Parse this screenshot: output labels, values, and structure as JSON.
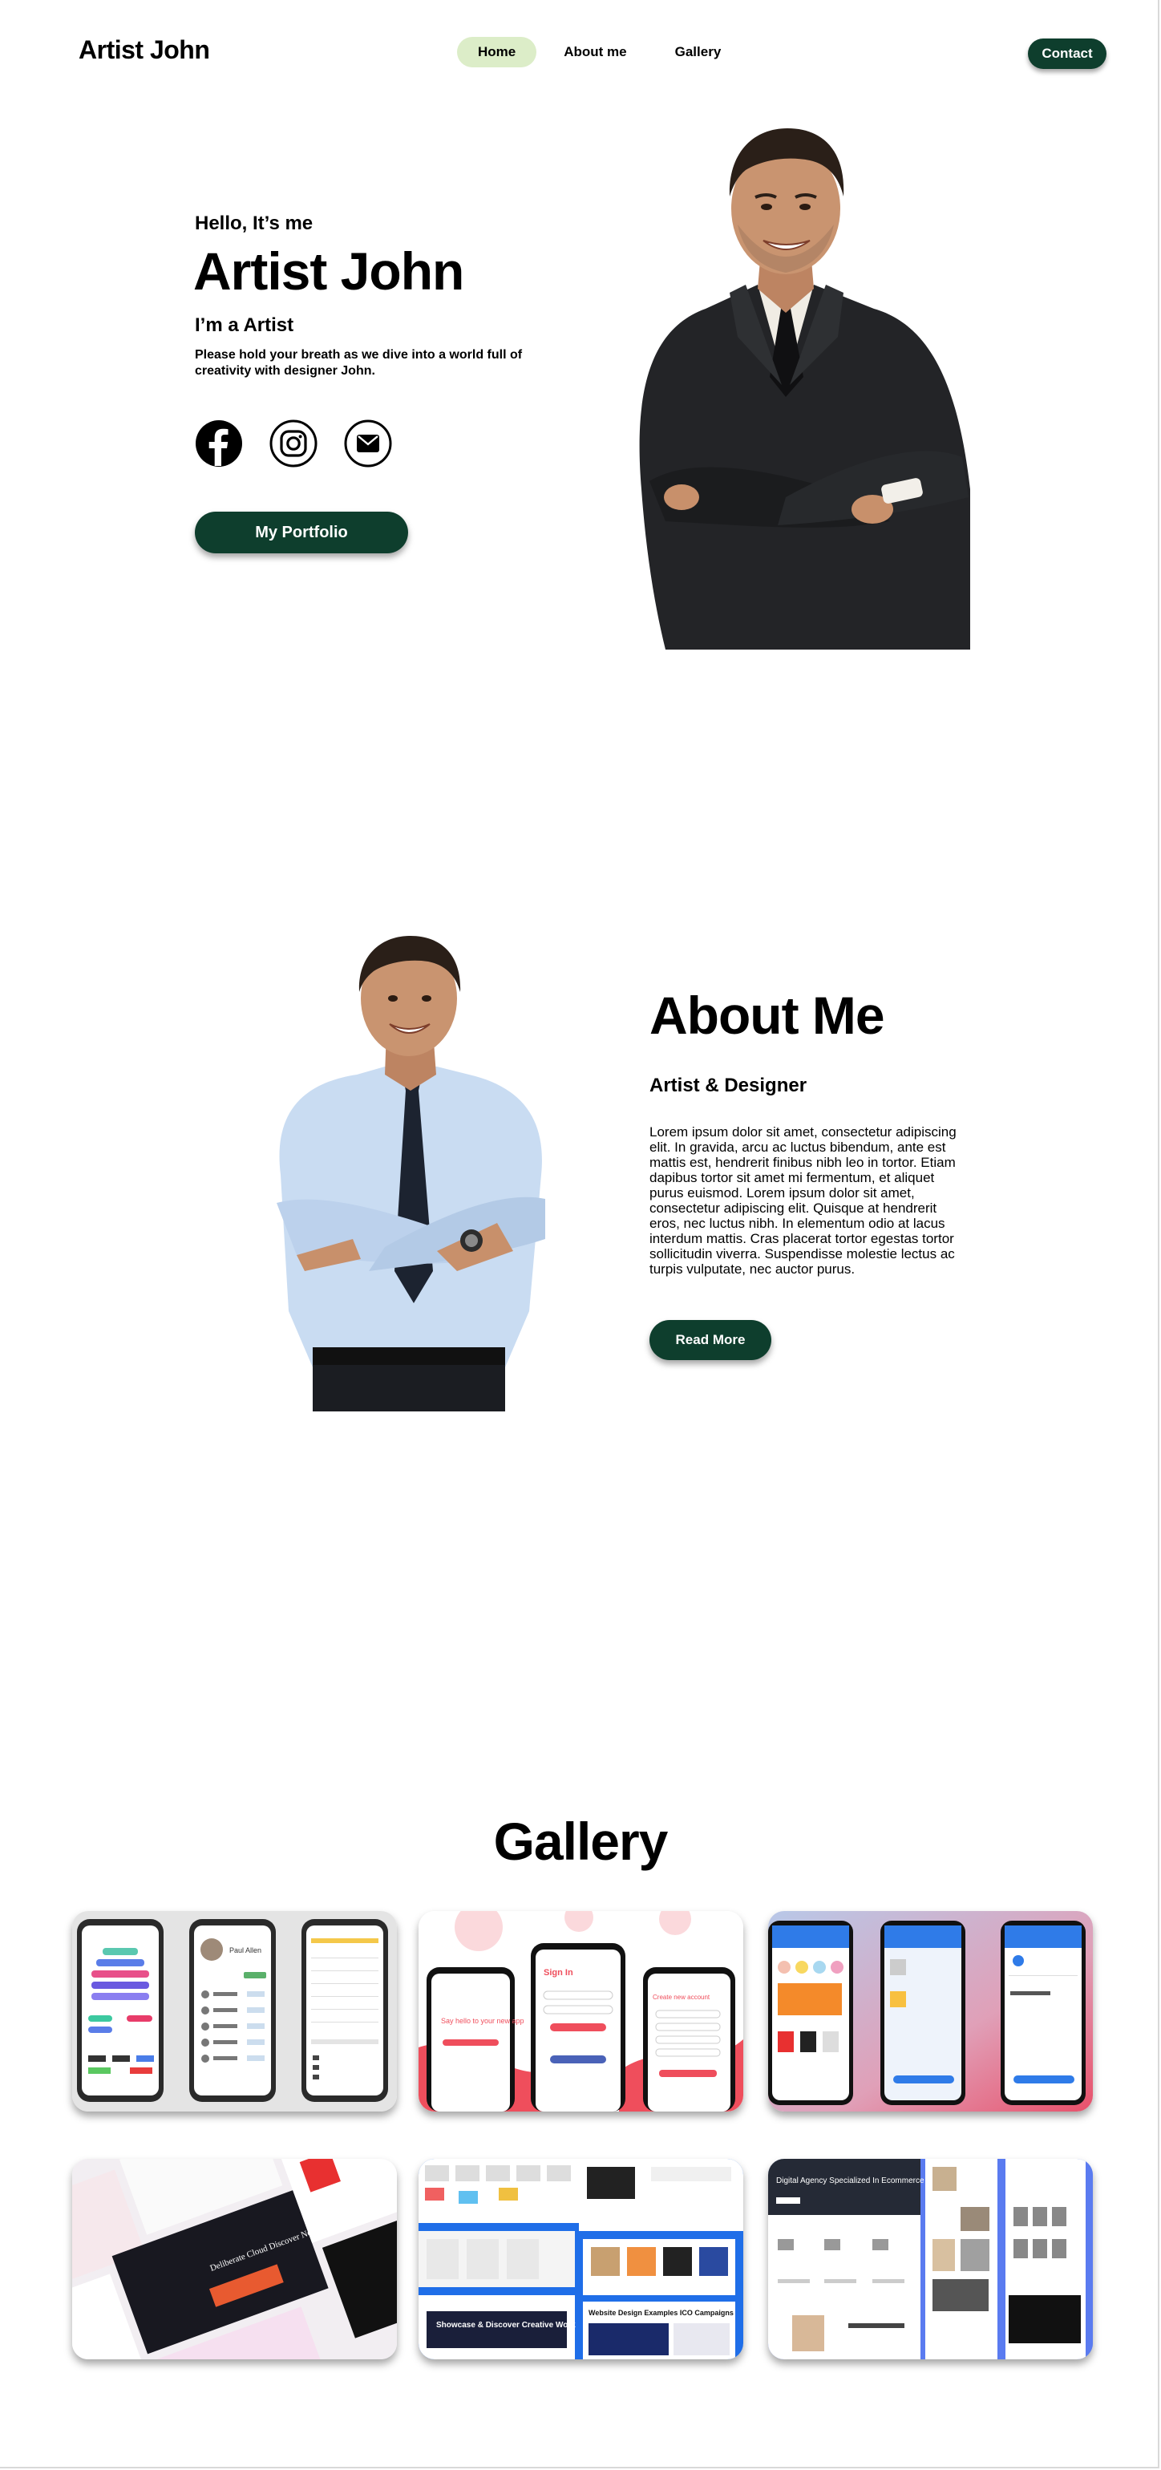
{
  "header": {
    "brand": "Artist John",
    "nav": [
      {
        "label": "Home",
        "active": true
      },
      {
        "label": "About me",
        "active": false
      },
      {
        "label": "Gallery",
        "active": false
      }
    ],
    "contact_label": "Contact"
  },
  "hero": {
    "greeting": "Hello, It’s me",
    "name": "Artist John",
    "role": "I’m a Artist",
    "description": "Please hold your breath as we dive into a world full of creativity with designer John.",
    "socials": [
      "facebook-icon",
      "instagram-icon",
      "mail-icon"
    ],
    "portfolio_label": "My Portfolio"
  },
  "about": {
    "title": "About Me",
    "subtitle": "Artist & Designer",
    "text": "Lorem ipsum dolor sit amet, consectetur adipiscing elit. In gravida, arcu ac luctus bibendum, ante est mattis est, hendrerit finibus nibh leo in tortor. Etiam dapibus tortor sit amet mi fermentum, et aliquet purus euismod. Lorem ipsum dolor sit amet, consectetur adipiscing elit. Quisque at hendrerit eros, nec luctus nibh. In elementum odio at lacus interdum mattis. Cras placerat tortor egestas tortor sollicitudin viverra. Suspendisse molestie lectus ac turpis vulputate, nec auctor purus.",
    "read_more_label": "Read More"
  },
  "gallery": {
    "title": "Gallery",
    "items": [
      {
        "caption": "",
        "texts": [
          "Paul Allen"
        ]
      },
      {
        "caption": "",
        "texts": [
          "Sign In",
          "Say hello to your new app",
          "Create new account"
        ]
      },
      {
        "caption": "",
        "texts": []
      },
      {
        "caption": "",
        "texts": [
          "Deliberate Cloud Discover New Treasures"
        ]
      },
      {
        "caption": "",
        "texts": [
          "Showcase & Discover Creative Work",
          "Website Design Examples ICO Campaigns"
        ]
      },
      {
        "caption": "",
        "texts": [
          "Digital Agency Specialized In Ecommerce"
        ]
      }
    ]
  },
  "colors": {
    "primary": "#0e3e2d",
    "active_nav": "#dcedc8",
    "background": "#ffffff"
  }
}
